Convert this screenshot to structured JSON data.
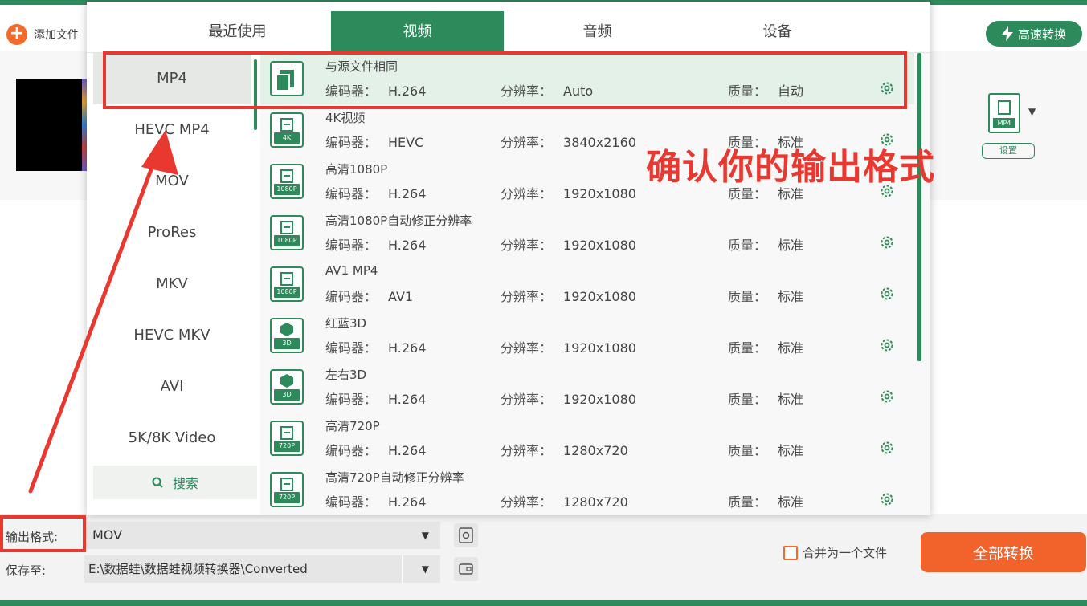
{
  "app": {
    "add_file": "添加文件",
    "turbo": "高速转换",
    "file_format_badge": "MP4",
    "file_settings": "设置"
  },
  "tabs": [
    {
      "label": "最近使用"
    },
    {
      "label": "视频"
    },
    {
      "label": "音频"
    },
    {
      "label": "设备"
    }
  ],
  "categories": [
    {
      "label": "MP4"
    },
    {
      "label": "HEVC MP4"
    },
    {
      "label": "MOV"
    },
    {
      "label": "ProRes"
    },
    {
      "label": "MKV"
    },
    {
      "label": "HEVC MKV"
    },
    {
      "label": "AVI"
    },
    {
      "label": "5K/8K Video"
    }
  ],
  "search_label": "搜索",
  "field_labels": {
    "encoder": "编码器：",
    "resolution": "分辨率：",
    "quality": "质量："
  },
  "presets": [
    {
      "name": "与源文件相同",
      "encoder": "H.264",
      "resolution": "Auto",
      "quality": "自动",
      "tag": ""
    },
    {
      "name": "4K视频",
      "encoder": "HEVC",
      "resolution": "3840x2160",
      "quality": "标准",
      "tag": "4K"
    },
    {
      "name": "高清1080P",
      "encoder": "H.264",
      "resolution": "1920x1080",
      "quality": "标准",
      "tag": "1080P"
    },
    {
      "name": "高清1080P自动修正分辨率",
      "encoder": "H.264",
      "resolution": "1920x1080",
      "quality": "标准",
      "tag": "1080P"
    },
    {
      "name": "AV1 MP4",
      "encoder": "AV1",
      "resolution": "1920x1080",
      "quality": "标准",
      "tag": "1080P"
    },
    {
      "name": "红蓝3D",
      "encoder": "H.264",
      "resolution": "1920x1080",
      "quality": "标准",
      "tag": "3D"
    },
    {
      "name": "左右3D",
      "encoder": "H.264",
      "resolution": "1920x1080",
      "quality": "标准",
      "tag": "3D"
    },
    {
      "name": "高清720P",
      "encoder": "H.264",
      "resolution": "1280x720",
      "quality": "标准",
      "tag": "720P"
    },
    {
      "name": "高清720P自动修正分辨率",
      "encoder": "H.264",
      "resolution": "1280x720",
      "quality": "标准",
      "tag": "720P"
    }
  ],
  "bottom": {
    "output_format_label": "输出格式:",
    "output_format_value": "MOV",
    "save_to_label": "保存至:",
    "save_to_value": "E:\\数据蛙\\数据蛙视频转换器\\Converted",
    "merge_label": "合并为一个文件",
    "convert_all": "全部转换"
  },
  "annotation": {
    "text": "确认你的输出格式",
    "color": "#e8382f"
  },
  "colors": {
    "brand_green": "#2d8a5a",
    "accent_orange": "#f2622b",
    "annotation_red": "#e8382f"
  }
}
